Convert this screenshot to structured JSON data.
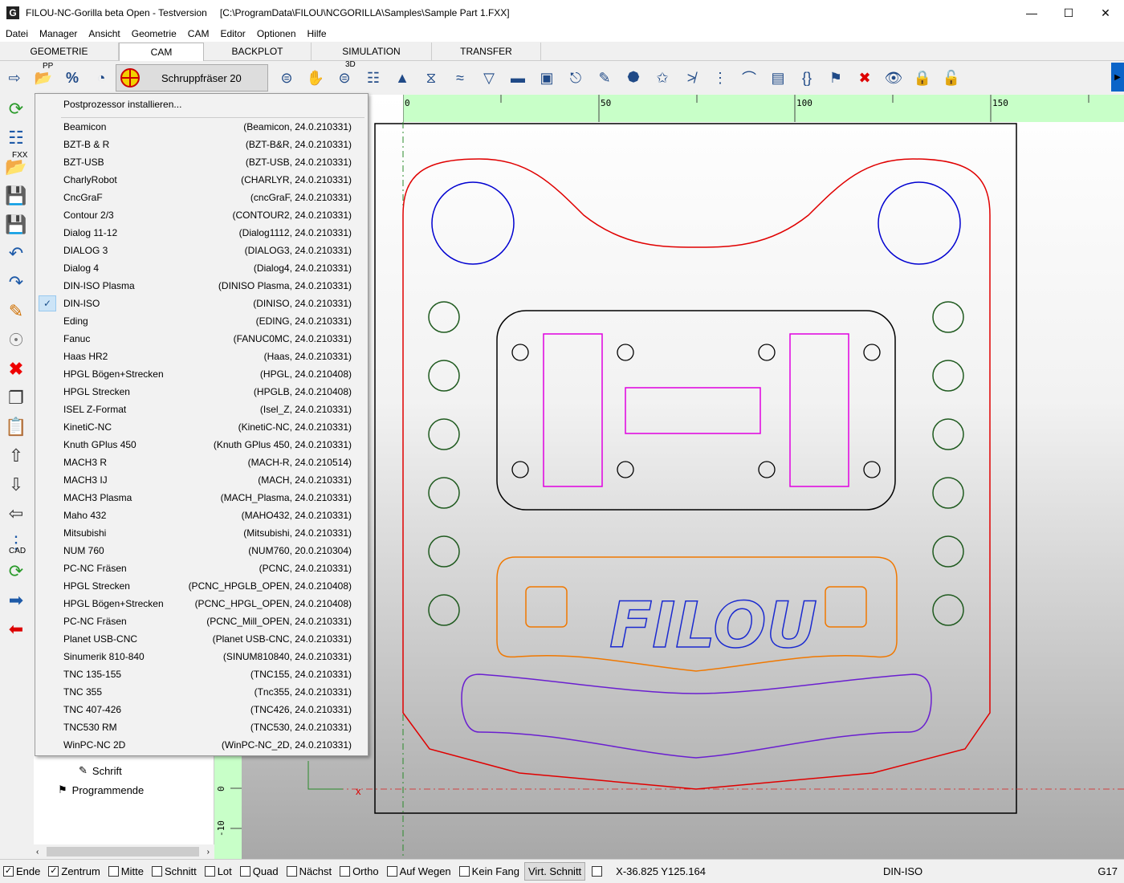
{
  "window": {
    "title": "FILOU-NC-Gorilla beta Open - Testversion",
    "path": "[C:\\ProgramData\\FILOU\\NCGORILLA\\Samples\\Sample Part 1.FXX]",
    "app_icon": "G"
  },
  "menu": [
    "Datei",
    "Manager",
    "Ansicht",
    "Geometrie",
    "CAM",
    "Editor",
    "Optionen",
    "Hilfe"
  ],
  "tabs": [
    {
      "label": "GEOMETRIE",
      "active": false
    },
    {
      "label": "CAM",
      "active": true
    },
    {
      "label": "BACKPLOT",
      "active": false
    },
    {
      "label": "SIMULATION",
      "active": false
    },
    {
      "label": "TRANSFER",
      "active": false
    }
  ],
  "toolbar": {
    "pp_label": "PP",
    "tool_label": "Schruppfräser 20",
    "d3_label": "3D"
  },
  "left_toolbar": {
    "fxx_label": "FXX",
    "cad_label": "CAD"
  },
  "tree": {
    "items": [
      {
        "label": "Schrift"
      },
      {
        "label": "Programmende"
      }
    ]
  },
  "postprocessor_menu": {
    "install_label": "Postprozessor installieren...",
    "items": [
      {
        "name": "Beamicon",
        "code": "(Beamicon, 24.0.210331)"
      },
      {
        "name": "BZT-B & R",
        "code": "(BZT-B&R, 24.0.210331)"
      },
      {
        "name": "BZT-USB",
        "code": "(BZT-USB, 24.0.210331)"
      },
      {
        "name": "CharlyRobot",
        "code": "(CHARLYR, 24.0.210331)"
      },
      {
        "name": "CncGraF",
        "code": "(cncGraF, 24.0.210331)"
      },
      {
        "name": "Contour 2/3",
        "code": "(CONTOUR2, 24.0.210331)"
      },
      {
        "name": "Dialog 11-12",
        "code": "(Dialog1112, 24.0.210331)"
      },
      {
        "name": "DIALOG 3",
        "code": "(DIALOG3, 24.0.210331)"
      },
      {
        "name": "Dialog 4",
        "code": "(Dialog4, 24.0.210331)"
      },
      {
        "name": "DIN-ISO Plasma",
        "code": "(DINISO Plasma, 24.0.210331)"
      },
      {
        "name": "DIN-ISO",
        "code": "(DINISO, 24.0.210331)",
        "checked": true
      },
      {
        "name": "Eding",
        "code": "(EDING, 24.0.210331)"
      },
      {
        "name": "Fanuc",
        "code": "(FANUC0MC, 24.0.210331)"
      },
      {
        "name": "Haas HR2",
        "code": "(Haas, 24.0.210331)"
      },
      {
        "name": "HPGL Bögen+Strecken",
        "code": "(HPGL, 24.0.210408)"
      },
      {
        "name": "HPGL Strecken",
        "code": "(HPGLB, 24.0.210408)"
      },
      {
        "name": "ISEL Z-Format",
        "code": "(Isel_Z, 24.0.210331)"
      },
      {
        "name": "KinetiC-NC",
        "code": "(KinetiC-NC, 24.0.210331)"
      },
      {
        "name": "Knuth GPlus 450",
        "code": "(Knuth GPlus 450, 24.0.210331)"
      },
      {
        "name": "MACH3 R",
        "code": "(MACH-R, 24.0.210514)"
      },
      {
        "name": "MACH3 IJ",
        "code": "(MACH, 24.0.210331)"
      },
      {
        "name": "MACH3 Plasma",
        "code": "(MACH_Plasma, 24.0.210331)"
      },
      {
        "name": "Maho 432",
        "code": "(MAHO432, 24.0.210331)"
      },
      {
        "name": "Mitsubishi",
        "code": "(Mitsubishi, 24.0.210331)"
      },
      {
        "name": "NUM 760",
        "code": "(NUM760, 20.0.210304)"
      },
      {
        "name": "PC-NC Fräsen",
        "code": "(PCNC, 24.0.210331)"
      },
      {
        "name": "HPGL Strecken",
        "code": "(PCNC_HPGLB_OPEN, 24.0.210408)"
      },
      {
        "name": "HPGL Bögen+Strecken",
        "code": "(PCNC_HPGL_OPEN, 24.0.210408)"
      },
      {
        "name": "PC-NC Fräsen",
        "code": "(PCNC_Mill_OPEN, 24.0.210331)"
      },
      {
        "name": "Planet USB-CNC",
        "code": "(Planet USB-CNC, 24.0.210331)"
      },
      {
        "name": "Sinumerik 810-840",
        "code": "(SINUM810840, 24.0.210331)"
      },
      {
        "name": "TNC 135-155",
        "code": "(TNC155, 24.0.210331)"
      },
      {
        "name": "TNC 355",
        "code": "(Tnc355, 24.0.210331)"
      },
      {
        "name": "TNC 407-426",
        "code": "(TNC426, 24.0.210331)"
      },
      {
        "name": "TNC530 RM",
        "code": "(TNC530, 24.0.210331)"
      },
      {
        "name": "WinPC-NC 2D",
        "code": "(WinPC-NC_2D, 24.0.210331)"
      }
    ]
  },
  "ruler": {
    "top_ticks": [
      "0",
      "50",
      "100",
      "150"
    ],
    "left_ticks": [
      "0",
      "-10"
    ]
  },
  "canvas": {
    "text": "FILOU",
    "origin_marker": "x"
  },
  "status": {
    "checks": [
      {
        "label": "Ende",
        "checked": true
      },
      {
        "label": "Zentrum",
        "checked": true
      },
      {
        "label": "Mitte",
        "checked": false
      },
      {
        "label": "Schnitt",
        "checked": false
      },
      {
        "label": "Lot",
        "checked": false
      },
      {
        "label": "Quad",
        "checked": false
      },
      {
        "label": "Nächst",
        "checked": false
      },
      {
        "label": "Ortho",
        "checked": false
      },
      {
        "label": "Auf Wegen",
        "checked": false
      },
      {
        "label": "Kein Fang",
        "checked": false
      }
    ],
    "virt_button": "Virt. Schnitt",
    "coords": "X-36.825 Y125.164",
    "mode": "DIN-ISO",
    "gcode": "G17"
  },
  "colors": {
    "outline_red": "#e00000",
    "circle_blue": "#0000d0",
    "circle_green": "#1f5a1f",
    "pocket_magenta": "#e000e0",
    "orange": "#f07800",
    "purple": "#6a1fd0",
    "ruler_green": "#c8ffc8"
  }
}
